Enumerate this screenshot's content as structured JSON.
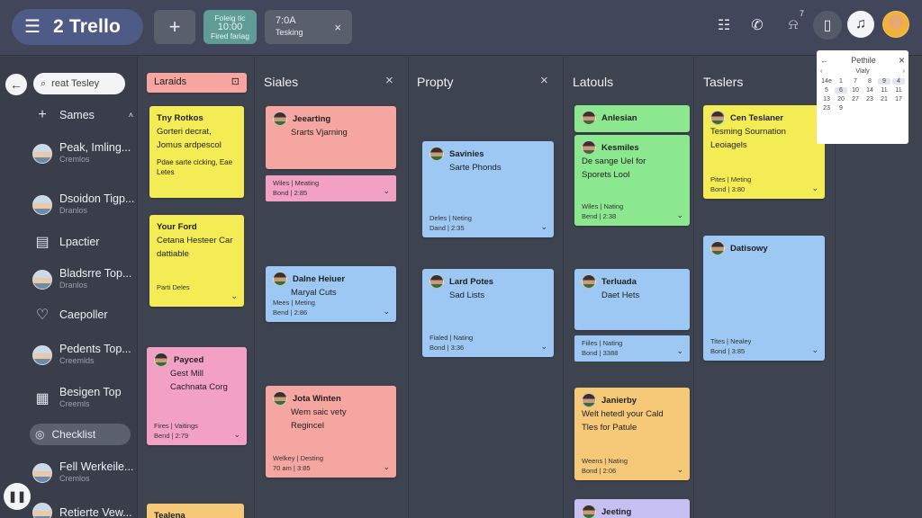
{
  "app": {
    "title": "2 Trello"
  },
  "topbar": {
    "add_label": "+",
    "chip1": {
      "line1": "Foleig tic",
      "line2": "10:00",
      "line3": "Fired fariag"
    },
    "chip2": {
      "line1": "7:0A",
      "line2": "Tesking",
      "close": "×"
    },
    "bell_count": "7"
  },
  "sidebar": {
    "search_value": "reat Tesley",
    "items": [
      {
        "label": "Sames",
        "glyph": "+",
        "arrow": "˄"
      },
      {
        "label": "Peak, Imling...",
        "sub": "Cremlos"
      },
      {
        "label": "Dsoidon Tigp...",
        "sub": "Dranlos"
      },
      {
        "label": "Lpactier"
      },
      {
        "label": "Bladsrre Top...",
        "sub": "Dranlos"
      },
      {
        "label": "Caepoller"
      },
      {
        "label": "Pedents Top...",
        "sub": "Creemlds"
      },
      {
        "label": "Besigen Top",
        "sub": "Creemls"
      },
      {
        "label": "Checklist"
      },
      {
        "label": "Fell Werkeile...",
        "sub": "Cremlos"
      },
      {
        "label": "Retierte Vew..."
      }
    ]
  },
  "columns": [
    {
      "title": "Laraids",
      "cards": [
        {
          "title": "Tny Rotkos",
          "body": "Gorteri decrat, Jomus ardpescol",
          "foot": "Pdae sarte cicking, Eae Letes"
        },
        {
          "title": "Your Ford",
          "body": "Cetana Hesteer Car dattiable",
          "foot": "Parti Deles"
        },
        {
          "title": "Payced",
          "body": "Gest Mill Cachnata Corg",
          "foot1": "Fires | Vaitings",
          "foot2": "Bend | 2:79"
        },
        {
          "title": "Tealena"
        }
      ]
    },
    {
      "title": "Siales",
      "cards": [
        {
          "title": "Jeearting",
          "body": "Srarts Vjarning",
          "foot1": "Wiles | Meating",
          "foot2": "Bond | 2:85"
        },
        {
          "title": "Dalne Heiuer",
          "body": "Maryal Cuts",
          "foot1": "Mees | Meting",
          "foot2": "Bend | 2:86"
        },
        {
          "title": "Jota Winten",
          "body": "Wem saic vety Regincel",
          "foot1": "Welkey | Desting",
          "foot2": "70 am | 3:85"
        }
      ]
    },
    {
      "title": "Propty",
      "cards": [
        {
          "title": "Savinies",
          "body": "Sarte Phonds",
          "foot1": "Deles | Neting",
          "foot2": "Dand | 2:35"
        },
        {
          "title": "Lard Potes",
          "body": "Sad Lists",
          "foot1": "Fialed | Nating",
          "foot2": "Bond | 3:36"
        }
      ]
    },
    {
      "title": "Latouls",
      "cards": [
        {
          "title": "Anlesian"
        },
        {
          "title": "Kesmiles",
          "body": "De sange Uel for Sporets Lool",
          "foot1": "Wiles | Nating",
          "foot2": "Bend | 2:38"
        },
        {
          "title": "Terluada",
          "body": "Daet Hets",
          "foot1": "Fiiles | Nating",
          "foot2": "Bond | 3388"
        },
        {
          "title": "Janierby",
          "body": "Welt hetedl your Cald Tles for Patule",
          "foot1": "Weens | Nating",
          "foot2": "Bond | 2:06"
        },
        {
          "title": "Jeeting"
        }
      ]
    },
    {
      "title": "Taslers",
      "cards": [
        {
          "title": "Cen Teslaner",
          "body": "Tesming Sournation Leoiagels",
          "foot1": "Pites | Meting",
          "foot2": "Bond | 3:80"
        },
        {
          "title": "Datisowy",
          "foot1": "Tites | Nealey",
          "foot2": "Bond | 3:85"
        }
      ]
    }
  ],
  "calendar": {
    "title": "Pethile",
    "month": "Vlaly",
    "days": [
      "14e",
      "1",
      "7",
      "8",
      "9",
      "4",
      "5",
      "6",
      "10",
      "14",
      "11",
      "11",
      "13",
      "20",
      "27",
      "23",
      "21",
      "17",
      "23",
      "9"
    ]
  },
  "colors": {
    "yellow": "#f4ec54",
    "pink": "#f3a0c5",
    "salmon": "#f6a6a0",
    "blue": "#9cc8f3",
    "green": "#8be88e",
    "orange": "#f5c978",
    "lavender": "#c6c0f2"
  }
}
